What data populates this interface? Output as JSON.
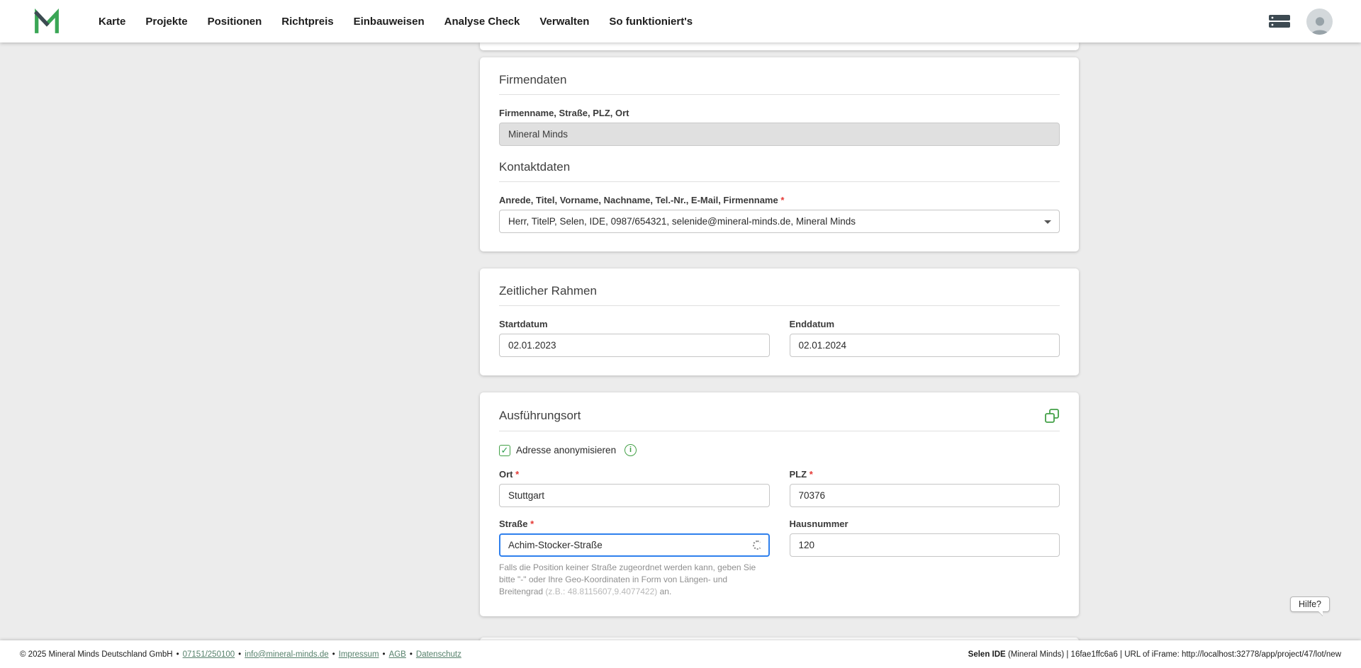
{
  "nav": {
    "items": [
      "Karte",
      "Projekte",
      "Positionen",
      "Richtpreis",
      "Einbauweisen",
      "Analyse Check",
      "Verwalten",
      "So funktioniert's"
    ]
  },
  "icons": {
    "check": "✓",
    "info": "i"
  },
  "required_marker": "*",
  "firmendaten": {
    "title": "Firmendaten",
    "company_label": "Firmenname, Straße, PLZ, Ort",
    "company_value": "Mineral Minds",
    "kontakt_title": "Kontaktdaten",
    "kontakt_label": "Anrede, Titel, Vorname, Nachname, Tel.-Nr., E-Mail, Firmenname",
    "kontakt_value": "Herr, TitelP, Selen, IDE, 0987/654321, selenide@mineral-minds.de, Mineral Minds"
  },
  "zeitraum": {
    "title": "Zeitlicher Rahmen",
    "start_label": "Startdatum",
    "start_value": "02.01.2023",
    "end_label": "Enddatum",
    "end_value": "02.01.2024"
  },
  "ausfuehrungsort": {
    "title": "Ausführungsort",
    "checkbox_label": "Adresse anonymisieren",
    "ort_label": "Ort",
    "ort_value": "Stuttgart",
    "plz_label": "PLZ",
    "plz_value": "70376",
    "strasse_label": "Straße",
    "strasse_value": "Achim-Stocker-Straße",
    "hausnummer_label": "Hausnummer",
    "hausnummer_value": "120",
    "helper": {
      "part1": "Falls die Position keiner Straße zugeordnet werden kann, geben Sie bitte \"-\" oder Ihre Geo-Koordinaten in Form von Längen- und Breitengrad ",
      "part2": "(z.B.: 48.8115607,9.4077422)",
      "part3": " an."
    }
  },
  "help_button_label": "Hilfe?",
  "footer": {
    "copyright": "© 2025 Mineral Minds Deutschland GmbH",
    "separator": "•",
    "links": [
      "07151/250100",
      "info@mineral-minds.de",
      "Impressum",
      "AGB",
      "Datenschutz"
    ],
    "right_app": "Selen IDE",
    "right_info": "(Mineral Minds) | 16fae1ffc6a6 | URL of iFrame: http://localhost:32778/app/project/47/lot/new"
  }
}
